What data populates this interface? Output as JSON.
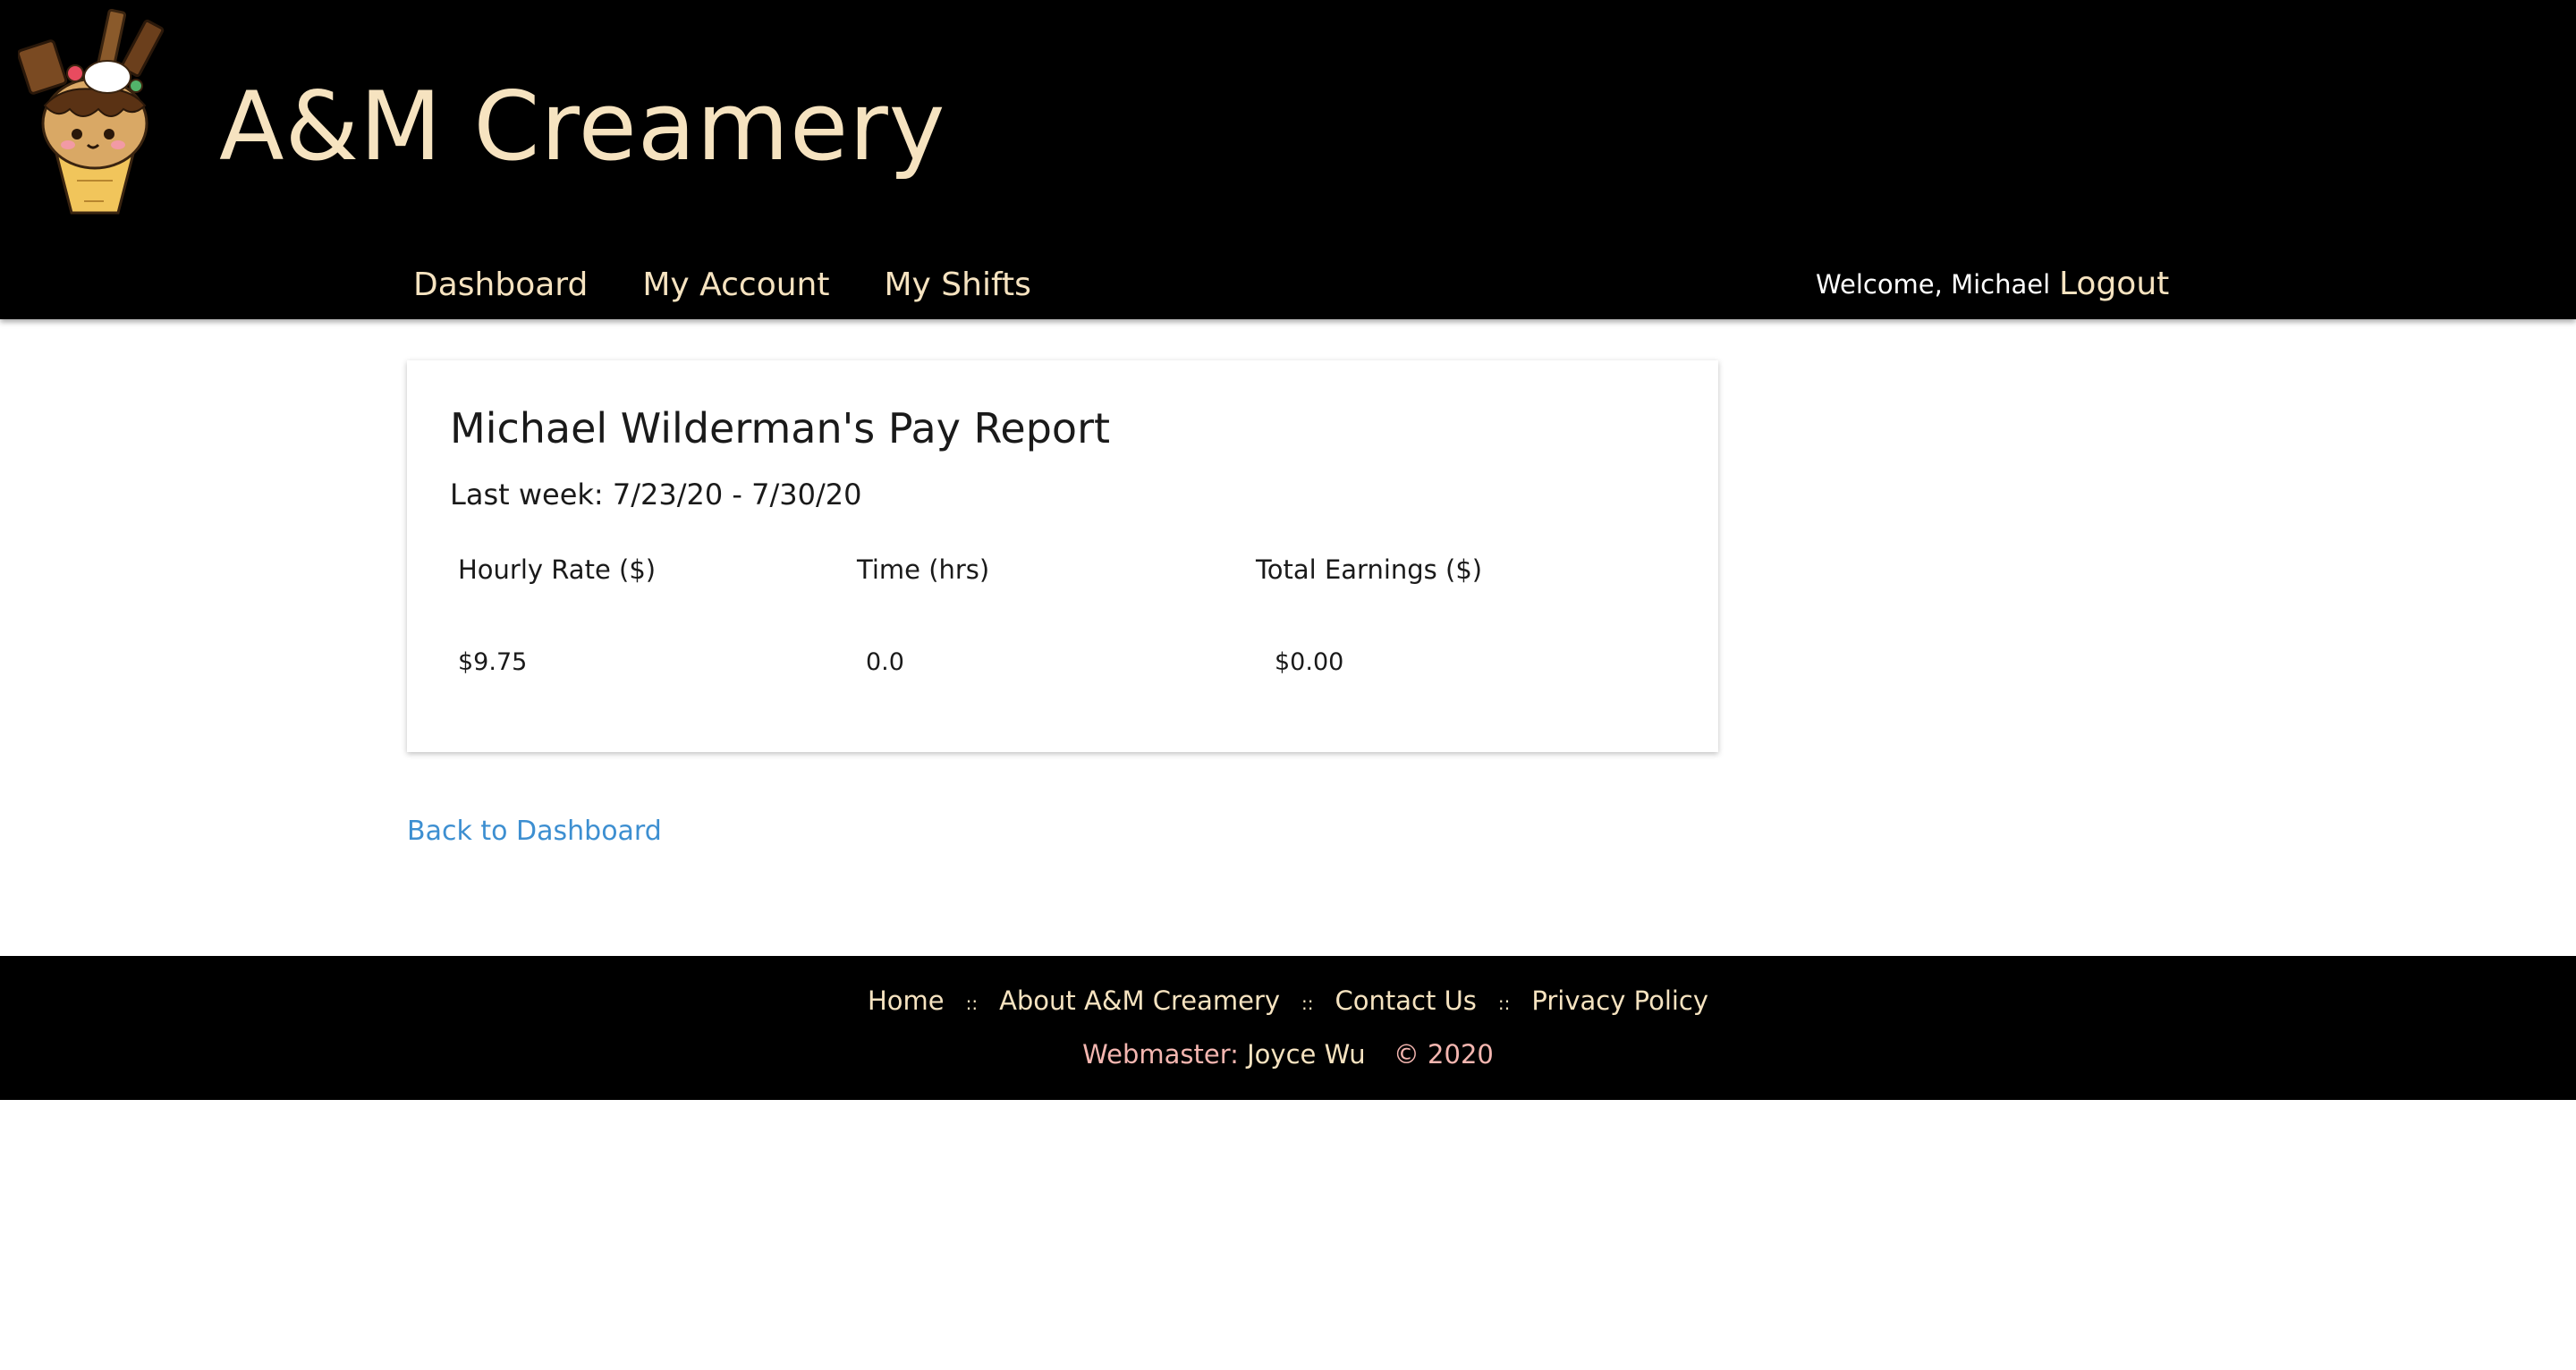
{
  "site": {
    "title": "A&M Creamery",
    "logo_icon": "ice-cream-cone-icon"
  },
  "nav": {
    "items": [
      {
        "label": "Dashboard"
      },
      {
        "label": "My Account"
      },
      {
        "label": "My Shifts"
      }
    ],
    "welcome": "Welcome, Michael",
    "logout": "Logout"
  },
  "report": {
    "title": "Michael Wilderman's Pay Report",
    "period": "Last week: 7/23/20 - 7/30/20",
    "headers": [
      "Hourly Rate ($)",
      "Time (hrs)",
      "Total Earnings ($)"
    ],
    "values": [
      "$9.75",
      "0.0",
      "$0.00"
    ]
  },
  "back_link": "Back to Dashboard",
  "footer": {
    "links": [
      {
        "label": "Home"
      },
      {
        "label": "About A&M Creamery"
      },
      {
        "label": "Contact Us"
      },
      {
        "label": "Privacy Policy"
      }
    ],
    "separator": "::",
    "webmaster_label": "Webmaster:",
    "webmaster_name": "Joyce Wu",
    "copyright": "© 2020"
  },
  "colors": {
    "header_bg": "#000000",
    "cream_text": "#f6e3c0",
    "link_blue": "#3d8fd1",
    "footer_pink": "#f4b6b0"
  }
}
